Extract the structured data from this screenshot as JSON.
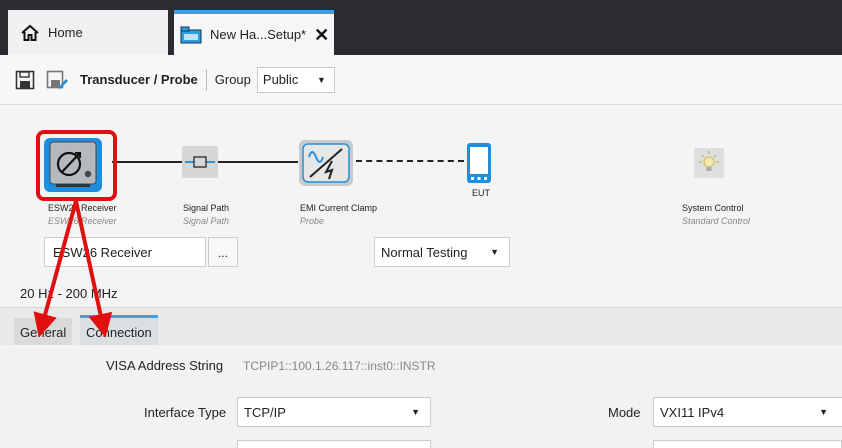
{
  "tabs": {
    "home_label": "Home",
    "setup_label": "New Ha...Setup*"
  },
  "toolbar": {
    "title": "Transducer / Probe",
    "group_label": "Group",
    "group_value": "Public"
  },
  "diagram": {
    "nodes": [
      {
        "label": "ESW26 Receiver",
        "sublabel": "ESW26 Receiver",
        "icon": "receiver-icon"
      },
      {
        "label": "Signal Path",
        "sublabel": "Signal Path",
        "icon": "signal-path-icon"
      },
      {
        "label": "EMI Current Clamp",
        "sublabel": "Probe",
        "icon": "current-clamp-icon"
      },
      {
        "label": "EUT",
        "sublabel": "",
        "icon": "eut-device-icon"
      },
      {
        "label": "System Control",
        "sublabel": "Standard Control",
        "icon": "lightbulb-icon"
      }
    ],
    "receiver_value": "ESW26 Receiver",
    "more_label": "...",
    "mode_value": "Normal Testing",
    "freq_range": "20 Hz - 200 MHz"
  },
  "lower_tabs": {
    "general": "General",
    "connection": "Connection"
  },
  "form": {
    "visa_label": "VISA Address String",
    "visa_value": "TCPIP1::100.1.26.117::inst0::INSTR",
    "interface_label": "Interface Type",
    "interface_value": "TCP/IP",
    "mode_label": "Mode",
    "mode_value": "VXI11 IPv4"
  },
  "colors": {
    "accent": "#3aa0e8",
    "annotation": "#e01010",
    "tabbar_bg": "#2a2c30"
  }
}
